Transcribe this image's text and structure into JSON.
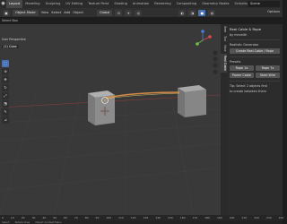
{
  "topbar": {
    "tabs": [
      "Layout",
      "Modeling",
      "Sculpting",
      "UV Editing",
      "Texture Paint",
      "Shading",
      "Animation",
      "Rendering",
      "Compositing",
      "Geometry Nodes",
      "Scripting"
    ],
    "scene": "Scene"
  },
  "header": {
    "mode": "Object Mode",
    "view": "View",
    "select": "Select",
    "add": "Add",
    "object": "Object",
    "orientation": "Global",
    "options": "Options"
  },
  "subbar": {
    "select_box": "Select Box"
  },
  "viewport": {
    "view_name": "User Perspective",
    "object_name": "(1) Cube"
  },
  "ntabs": [
    "Item",
    "Tool",
    "View",
    "Real Cable"
  ],
  "npanel": {
    "title": "Real Cable & Rope",
    "by": "by mrsmith",
    "realistic_generator": "Realistic Generator",
    "create_btn": "Create Real Cable / Rope",
    "presets_label": "Presets",
    "rope_1x": "Rope 1x",
    "rope_7x": "Rope 7x",
    "power_cable": "Power Cable",
    "steel_wire": "Steel Wire",
    "tip": "Tip: Select 2 objects first",
    "tip2": "to create between them"
  },
  "timeline": {
    "frames": [
      "0",
      "10",
      "20",
      "30",
      "40",
      "50",
      "60",
      "70",
      "80",
      "90",
      "100",
      "110",
      "120",
      "130",
      "140",
      "150",
      "160",
      "170",
      "180",
      "190",
      "200",
      "210",
      "220",
      "230",
      "240",
      "250"
    ]
  },
  "statusbar": {
    "select": "Select",
    "rotate": "Rotate View",
    "context": "Object Context Menu"
  },
  "colors": {
    "viewport_bg": "#393939",
    "cube_top": "#a2a2a2",
    "cube_front": "#878787",
    "cable": "#d48b47",
    "accent": "#4772b3"
  }
}
